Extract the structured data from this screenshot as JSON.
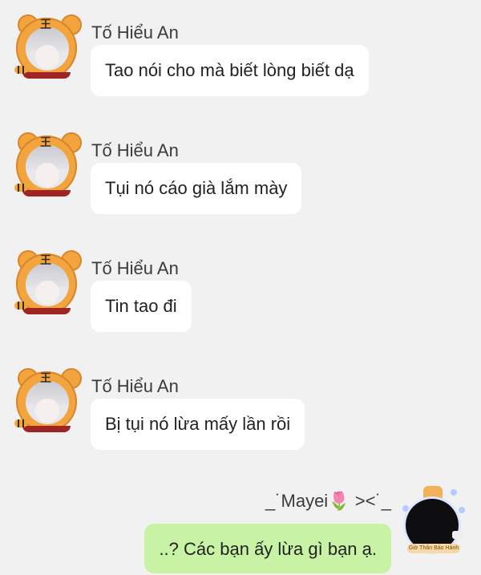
{
  "chat": {
    "incoming": [
      {
        "sender": "Tố Hiểu An",
        "text": "Tao nói cho mà biết lòng biết dạ"
      },
      {
        "sender": "Tố Hiểu An",
        "text": "Tụi nó cáo già lắm mày"
      },
      {
        "sender": "Tố Hiểu An",
        "text": "Tin tao đi"
      },
      {
        "sender": "Tố Hiểu An",
        "text": "Bị tụi nó lừa mấy lần rồi"
      }
    ],
    "outgoing": {
      "sender_prefix": "_˙Mayei",
      "sender_emoji": "🌷",
      "sender_suffix": "><˙_",
      "text": "..? Các bạn ấy lừa gì bạn ạ."
    },
    "avatar_badge_text": "Giờ Thân Bảo Hành",
    "colors": {
      "background": "#f1f1f1",
      "incoming_bubble": "#ffffff",
      "outgoing_bubble": "#c9f3a4",
      "avatar_frame": "#f2a43e"
    }
  }
}
